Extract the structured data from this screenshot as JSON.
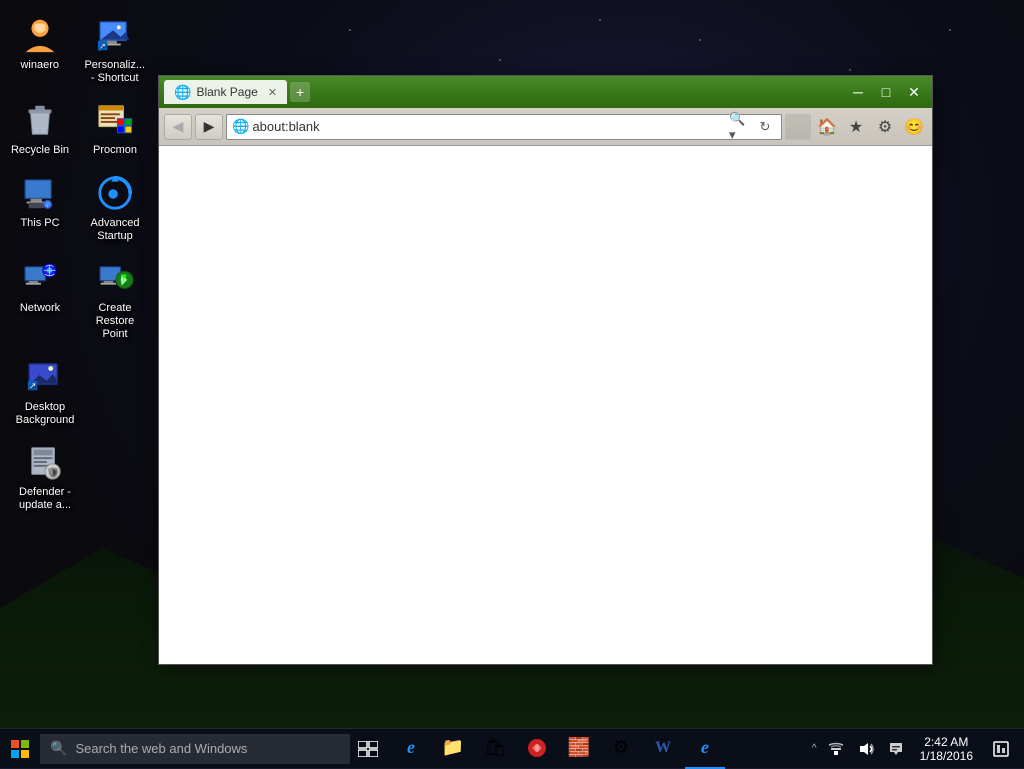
{
  "desktop": {
    "icons": [
      {
        "id": "winaero",
        "label": "winaero",
        "icon": "👤",
        "color": "#ffa500"
      },
      {
        "id": "personalization",
        "label": "Personaliz... - Shortcut",
        "icon": "🖥",
        "color": "#4a9eff"
      },
      {
        "id": "recycle-bin",
        "label": "Recycle Bin",
        "icon": "🗑",
        "color": "#aaaaaa"
      },
      {
        "id": "procmon",
        "label": "Procmon",
        "icon": "📊",
        "color": "#ff8800"
      },
      {
        "id": "this-pc",
        "label": "This PC",
        "icon": "💻",
        "color": "#4a9eff"
      },
      {
        "id": "advanced-startup",
        "label": "Advanced Startup",
        "icon": "🔄",
        "color": "#1e90ff"
      },
      {
        "id": "network",
        "label": "Network",
        "icon": "🌐",
        "color": "#4a9eff"
      },
      {
        "id": "create-restore-point",
        "label": "Create Restore Point",
        "icon": "🛡",
        "color": "#1e90ff"
      },
      {
        "id": "desktop-background",
        "label": "Desktop Background",
        "icon": "🖥",
        "color": "#4a9eff"
      },
      {
        "id": "defender",
        "label": "Defender - update a...",
        "icon": "🛡",
        "color": "#aaaaaa"
      }
    ]
  },
  "browser": {
    "title": "Blank Page",
    "url": "about:blank",
    "tab_label": "Blank Page",
    "tab_icon": "🌐",
    "buttons": {
      "back": "◀",
      "forward": "▶",
      "minimize": "─",
      "maximize": "□",
      "close": "✕"
    },
    "toolbar": {
      "search_placeholder": "about:blank",
      "home_icon": "🏠",
      "star_icon": "★",
      "settings_icon": "⚙",
      "emoji_icon": "😊"
    }
  },
  "taskbar": {
    "search_placeholder": "Search the web and Windows",
    "clock": {
      "time": "2:42 AM",
      "date": "1/18/2016"
    },
    "apps": [
      {
        "id": "edge",
        "label": "Edge",
        "icon": "e",
        "active": false
      },
      {
        "id": "explorer",
        "label": "File Explorer",
        "icon": "📁",
        "active": false
      },
      {
        "id": "store",
        "label": "Store",
        "icon": "🛍",
        "active": false
      },
      {
        "id": "paint",
        "label": "Paint",
        "icon": "🎨",
        "active": false
      },
      {
        "id": "lego",
        "label": "Lego",
        "icon": "🧱",
        "active": false
      },
      {
        "id": "settings2",
        "label": "Settings",
        "icon": "⚙",
        "active": false
      },
      {
        "id": "word",
        "label": "Word",
        "icon": "W",
        "active": false
      },
      {
        "id": "ie",
        "label": "Internet Explorer",
        "icon": "e",
        "active": true
      }
    ],
    "tray": {
      "chevron": "^",
      "network": "📶",
      "volume": "🔊",
      "chat": "💬"
    }
  }
}
